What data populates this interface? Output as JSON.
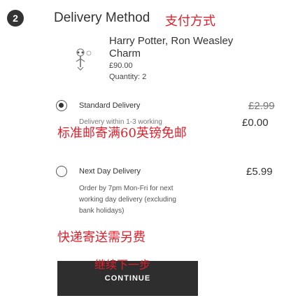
{
  "step": {
    "number": "2",
    "title": "Delivery Method",
    "annotation": "支付方式"
  },
  "product": {
    "name": "Harry Potter, Ron Weasley Charm",
    "price": "£90.00",
    "quantity": "Quantity: 2",
    "icon": "charm-image"
  },
  "options": [
    {
      "label": "Standard Delivery",
      "selected": true,
      "original_price": "£2.99",
      "price": "£0.00",
      "description": "Delivery within 1-3 working",
      "annotation": "标准邮寄满60英镑免邮"
    },
    {
      "label": "Next Day Delivery",
      "selected": false,
      "price": "£5.99",
      "description_lines": [
        "Order by 7pm Mon-Fri for next",
        "working day delivery (excluding",
        "bank holidays)"
      ],
      "annotation": "快递寄送需另费"
    }
  ],
  "continue": {
    "label": "CONTINUE",
    "annotation": "继续下一步"
  },
  "colors": {
    "button_bg": "#2e2e2e",
    "annotation_red": "#e0212d"
  }
}
